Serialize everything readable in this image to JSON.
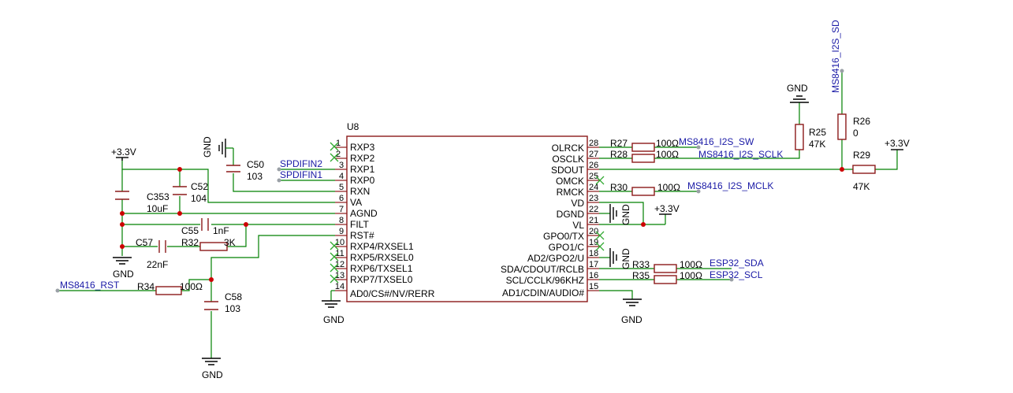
{
  "ic": {
    "ref": "U8",
    "left_pins": [
      {
        "num": "1",
        "name": "RXP3",
        "nc": true
      },
      {
        "num": "2",
        "name": "RXP2",
        "nc": true
      },
      {
        "num": "3",
        "name": "RXP1",
        "nc": false
      },
      {
        "num": "4",
        "name": "RXP0",
        "nc": false
      },
      {
        "num": "5",
        "name": "RXN",
        "nc": false
      },
      {
        "num": "6",
        "name": "VA",
        "nc": false
      },
      {
        "num": "7",
        "name": "AGND",
        "nc": false
      },
      {
        "num": "8",
        "name": "FILT",
        "nc": false
      },
      {
        "num": "9",
        "name": "RST#",
        "nc": false
      },
      {
        "num": "10",
        "name": "RXP4/RXSEL1",
        "nc": true
      },
      {
        "num": "11",
        "name": "RXP5/RXSEL0",
        "nc": true
      },
      {
        "num": "12",
        "name": "RXP6/TXSEL1",
        "nc": true
      },
      {
        "num": "13",
        "name": "RXP7/TXSEL0",
        "nc": true
      },
      {
        "num": "14",
        "name": "AD0/CS#/NV/RERR",
        "nc": false
      }
    ],
    "right_pins": [
      {
        "num": "28",
        "name": "OLRCK",
        "nc": false
      },
      {
        "num": "27",
        "name": "OSCLK",
        "nc": false
      },
      {
        "num": "26",
        "name": "SDOUT",
        "nc": false
      },
      {
        "num": "25",
        "name": "OMCK",
        "nc": true
      },
      {
        "num": "24",
        "name": "RMCK",
        "nc": false
      },
      {
        "num": "23",
        "name": "VD",
        "nc": false
      },
      {
        "num": "22",
        "name": "DGND",
        "nc": false
      },
      {
        "num": "21",
        "name": "VL",
        "nc": false
      },
      {
        "num": "20",
        "name": "GPO0/TX",
        "nc": true
      },
      {
        "num": "19",
        "name": "GPO1/C",
        "nc": true
      },
      {
        "num": "18",
        "name": "AD2/GPO2/U",
        "nc": false
      },
      {
        "num": "17",
        "name": "SDA/CDOUT/RCLB",
        "nc": false
      },
      {
        "num": "16",
        "name": "SCL/CCLK/96KHZ",
        "nc": false
      },
      {
        "num": "15",
        "name": "AD1/CDIN/AUDIO#",
        "nc": false
      }
    ]
  },
  "components": {
    "R27": {
      "ref": "R27",
      "value": "100Ω"
    },
    "R28": {
      "ref": "R28",
      "value": "100Ω"
    },
    "R30": {
      "ref": "R30",
      "value": "100Ω"
    },
    "R33": {
      "ref": "R33",
      "value": "100Ω"
    },
    "R35": {
      "ref": "R35",
      "value": "100Ω"
    },
    "R25": {
      "ref": "R25",
      "value": "47K"
    },
    "R26": {
      "ref": "R26",
      "value": "0"
    },
    "R29": {
      "ref": "R29",
      "value": "47K"
    },
    "R32": {
      "ref": "R32",
      "value": "3K"
    },
    "R34": {
      "ref": "R34",
      "value": "100Ω"
    },
    "C50": {
      "ref": "C50",
      "value": "103"
    },
    "C52": {
      "ref": "C52",
      "value": "104"
    },
    "C353": {
      "ref": "C353",
      "value": "10uF"
    },
    "C55": {
      "ref": "C55",
      "value": "1nF"
    },
    "C57": {
      "ref": "C57",
      "value": "22nF"
    },
    "C58": {
      "ref": "C58",
      "value": "103"
    }
  },
  "nets": {
    "spdifin2": "SPDIFIN2",
    "spdifin1": "SPDIFIN1",
    "i2s_sw": "MS8416_I2S_SW",
    "i2s_sclk": "MS8416_I2S_SCLK",
    "i2s_mclk": "MS8416_I2S_MCLK",
    "i2s_sd": "MS8416_I2S_SD",
    "esp_sda": "ESP32_SDA",
    "esp_scl": "ESP32_SCL",
    "rst": "MS8416_RST"
  },
  "power": {
    "gnd": "GND",
    "v33": "+3.3V"
  }
}
